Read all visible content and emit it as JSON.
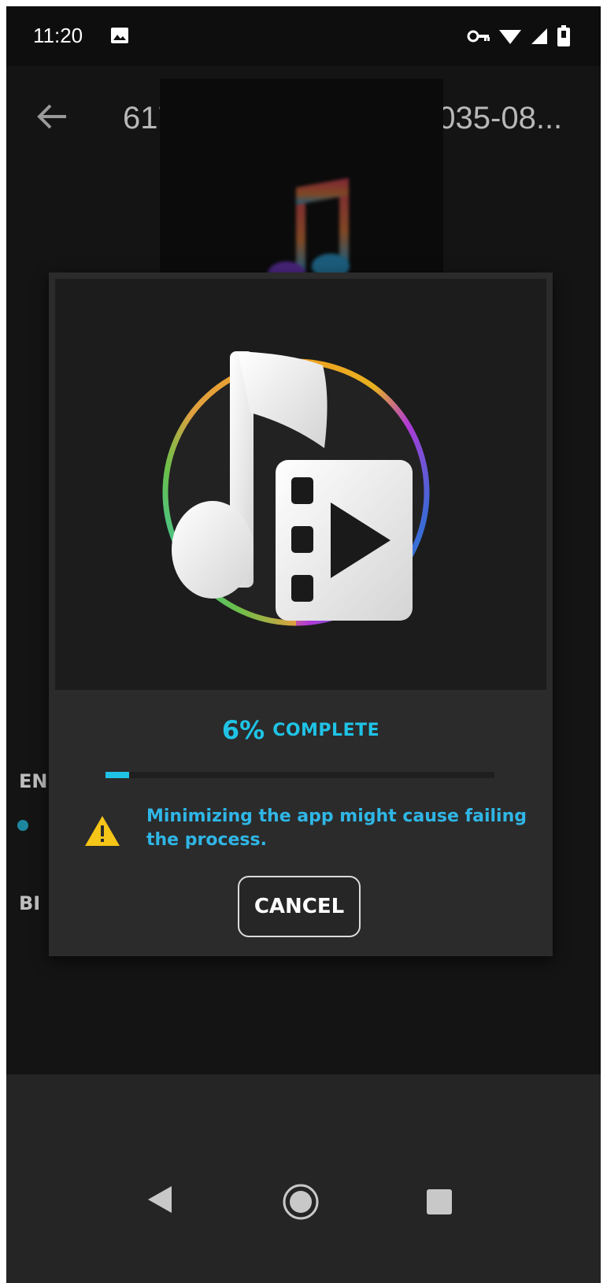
{
  "status_bar": {
    "time": "11:20",
    "icons": [
      "image-icon",
      "vpn-key-icon",
      "wifi-icon",
      "cell-signal-icon",
      "battery-icon"
    ]
  },
  "app_bar": {
    "title": "617c3cca-1b9a-46f9-9035-08...",
    "back_icon": "arrow-left-icon"
  },
  "background": {
    "label_en": "EN",
    "label_bi": "BI"
  },
  "dialog": {
    "progress_percent_label": "6%",
    "progress_status": "COMPLETE",
    "progress_fraction": 0.06,
    "warning_text": "Minimizing the app might cause failing the process.",
    "cancel_label": "CANCEL"
  },
  "nav_bar": {
    "items": [
      "back-triangle-icon",
      "home-circle-icon",
      "recents-square-icon"
    ]
  },
  "colors": {
    "accent": "#1fc3e6",
    "warning": "#f5c518",
    "dialog_bg": "#2b2b2b"
  }
}
